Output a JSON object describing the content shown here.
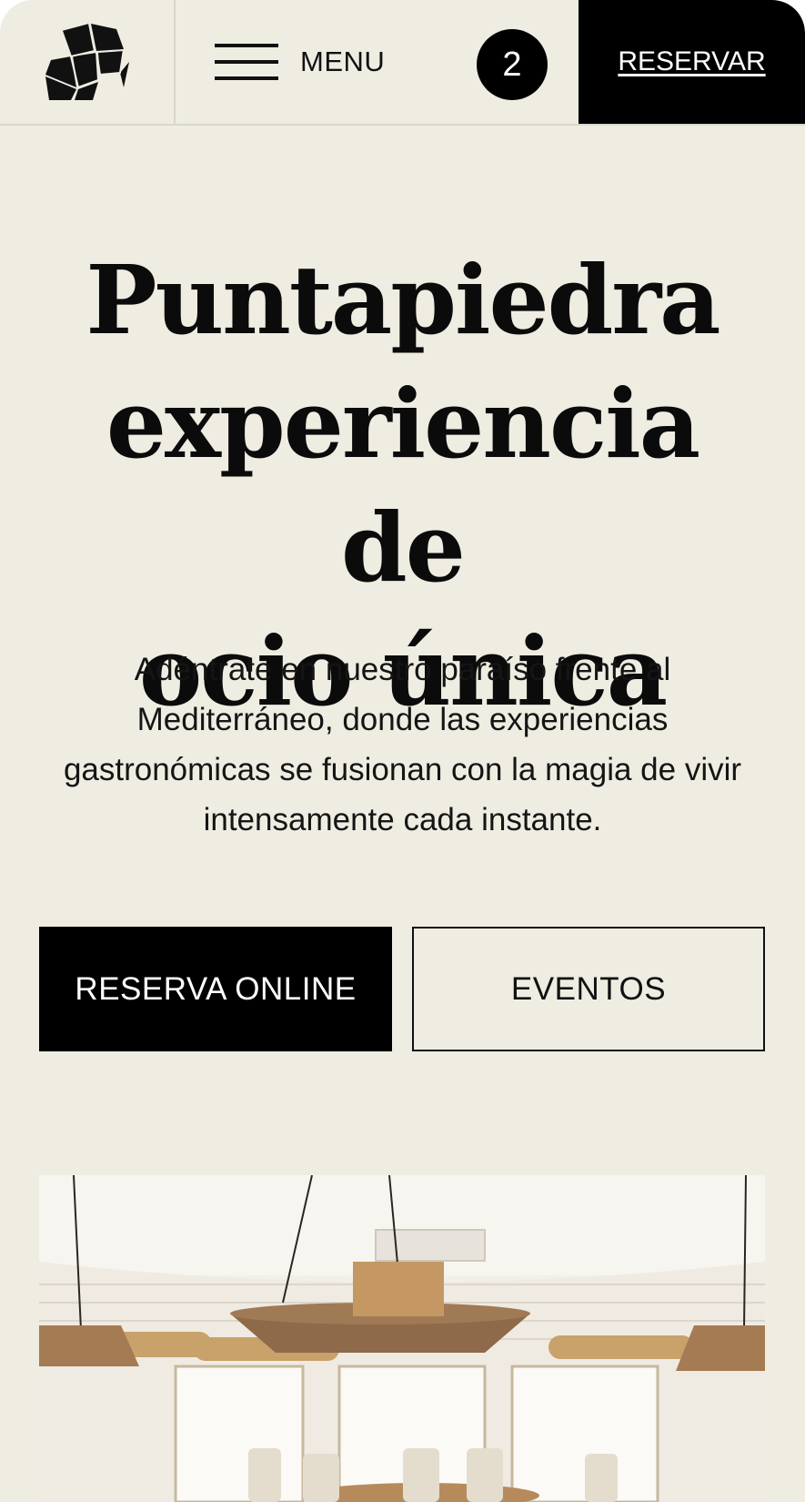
{
  "header": {
    "logo_icon": "elephant-logo-icon",
    "menu_icon": "hamburger-icon",
    "menu_label": "MENU",
    "cart_count": "2",
    "reserve_label": "RESERVAR"
  },
  "hero": {
    "title_lines": [
      "Puntapiedra",
      "experiencia de",
      "ocio única"
    ],
    "subtitle": "Adéntrate en nuestro paraíso frente al Mediterráneo, donde las experiencias gastronómicas se fusionan con la magia de vivir intensamente cada instante."
  },
  "actions": {
    "primary_label": "RESERVA ONLINE",
    "secondary_label": "EVENTOS"
  },
  "colors": {
    "background": "#efede2",
    "accent": "#000000",
    "text": "#0b0b0b"
  }
}
